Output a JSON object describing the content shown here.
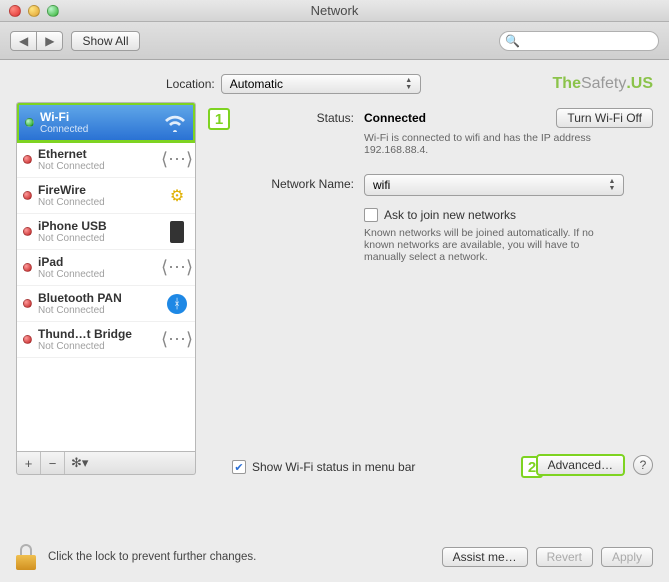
{
  "window": {
    "title": "Network"
  },
  "toolbar": {
    "show_all": "Show All"
  },
  "location": {
    "label": "Location:",
    "value": "Automatic"
  },
  "brand": {
    "the": "The",
    "safety": "Safety",
    "us": ".US"
  },
  "sidebar": {
    "items": [
      {
        "name": "Wi-Fi",
        "status": "Connected",
        "dot": "green",
        "icon": "wifi"
      },
      {
        "name": "Ethernet",
        "status": "Not Connected",
        "dot": "red",
        "icon": "sync"
      },
      {
        "name": "FireWire",
        "status": "Not Connected",
        "dot": "red",
        "icon": "firewire"
      },
      {
        "name": "iPhone USB",
        "status": "Not Connected",
        "dot": "red",
        "icon": "usb"
      },
      {
        "name": "iPad",
        "status": "Not Connected",
        "dot": "red",
        "icon": "sync"
      },
      {
        "name": "Bluetooth PAN",
        "status": "Not Connected",
        "dot": "red",
        "icon": "bluetooth"
      },
      {
        "name": "Thund…t Bridge",
        "status": "Not Connected",
        "dot": "red",
        "icon": "sync"
      }
    ],
    "footer": {
      "plus": "+",
      "minus": "−",
      "gear": "✻▾"
    }
  },
  "markers": {
    "one": "1",
    "two": "2"
  },
  "content": {
    "status_label": "Status:",
    "status_value": "Connected",
    "turn_off": "Turn Wi-Fi Off",
    "status_desc": "Wi-Fi is connected to wifi and has the IP address 192.168.88.4.",
    "network_name_label": "Network Name:",
    "network_name_value": "wifi",
    "ask_join": "Ask to join new networks",
    "known_desc": "Known networks will be joined automatically. If no known networks are available, you will have to manually select a network.",
    "show_status_check": "✔",
    "show_status_label": "Show Wi-Fi status in menu bar",
    "advanced": "Advanced…",
    "help": "?"
  },
  "footer": {
    "lock_text": "Click the lock to prevent further changes.",
    "assist": "Assist me…",
    "revert": "Revert",
    "apply": "Apply"
  }
}
